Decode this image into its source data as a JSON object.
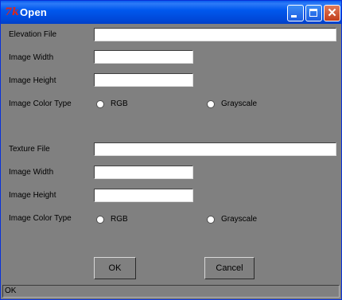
{
  "window": {
    "title": "Open",
    "icon_name": "tk-feather-icon",
    "icon_glyph": "7k"
  },
  "elevation": {
    "file_label": "Elevation File",
    "file_value": "",
    "width_label": "Image Width",
    "width_value": "",
    "height_label": "Image Height",
    "height_value": "",
    "color_type_label": "Image Color Type",
    "option_rgb": "RGB",
    "option_grayscale": "Grayscale"
  },
  "texture": {
    "file_label": "Texture File",
    "file_value": "",
    "width_label": "Image Width",
    "width_value": "",
    "height_label": "Image Height",
    "height_value": "",
    "color_type_label": "Image Color Type",
    "option_rgb": "RGB",
    "option_grayscale": "Grayscale"
  },
  "buttons": {
    "ok": "OK",
    "cancel": "Cancel"
  },
  "status": {
    "text": "OK"
  },
  "colors": {
    "background": "#808080",
    "titlebar": "#0058ee",
    "field": "#ffffff"
  }
}
